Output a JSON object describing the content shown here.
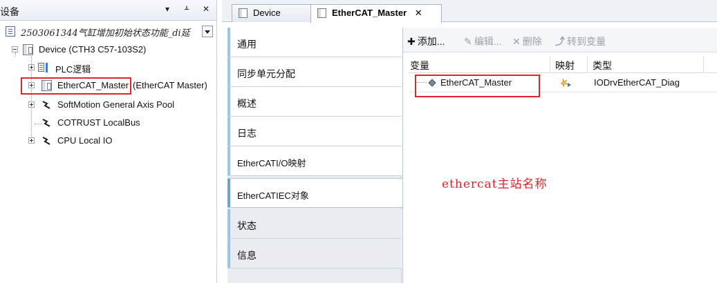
{
  "device_panel": {
    "title": "设备",
    "controls": [
      "▾",
      "ᚆ",
      "✕"
    ],
    "project_name": "2503061344气缸增加初始状态功能_di延",
    "tree": [
      {
        "label": "Device (CTH3 C57-103S2)",
        "icon": "device-icon"
      },
      {
        "label": "PLC逻辑",
        "icon": "plc-logic-icon"
      },
      {
        "label": "EtherCAT_Master",
        "suffix": "(EtherCAT Master)",
        "icon": "ethercat-master-icon",
        "highlighted": true
      },
      {
        "label": "SoftMotion General Axis Pool",
        "icon": "softmotion-icon"
      },
      {
        "label": "COTRUST LocalBus",
        "icon": "localbus-icon"
      },
      {
        "label": "CPU Local IO",
        "icon": "local-io-icon"
      }
    ]
  },
  "doc_tabs": [
    {
      "label": "Device",
      "active": false
    },
    {
      "label": "EtherCAT_Master",
      "active": true,
      "close": "✕"
    }
  ],
  "side_tabs": [
    "通用",
    "同步单元分配",
    "概述",
    "日志",
    "EtherCATI/O映射",
    "EtherCATIEC对象",
    "状态",
    "信息"
  ],
  "selected_side_tab": "EtherCATIEC对象",
  "toolbar": {
    "add": "添加...",
    "edit": "编辑...",
    "delete": "删除",
    "goto": "转到变量"
  },
  "grid": {
    "headers": [
      "变量",
      "映射",
      "类型"
    ],
    "rows": [
      {
        "variable": "EtherCAT_Master",
        "type": "IODrvEtherCAT_Diag"
      }
    ]
  },
  "annotation": "ethercat主站名称",
  "colors": {
    "highlight_box": "#e0242a",
    "tab_accent": "#6ea0d4"
  }
}
